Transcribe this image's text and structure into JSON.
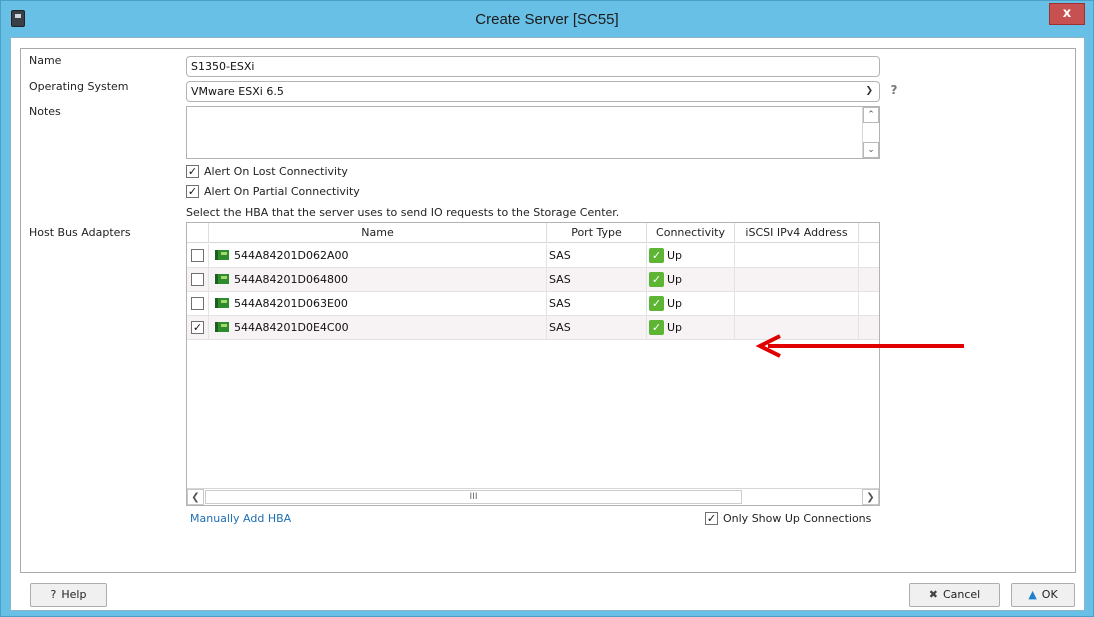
{
  "window": {
    "title": "Create Server [SC55]",
    "close_label": "x"
  },
  "form": {
    "name_label": "Name",
    "name_value": "S1350-ESXi",
    "os_label": "Operating System",
    "os_value": "VMware ESXi 6.5",
    "notes_label": "Notes",
    "notes_value": "",
    "help_q": "?",
    "alert_lost": {
      "label": "Alert On Lost Connectivity",
      "checked": true
    },
    "alert_partial": {
      "label": "Alert On Partial Connectivity",
      "checked": true
    },
    "hba_instruction": "Select the HBA that the server uses to send IO requests to the Storage Center.",
    "hba_label": "Host Bus Adapters"
  },
  "table": {
    "columns": [
      "Name",
      "Port Type",
      "Connectivity",
      "iSCSI IPv4 Address"
    ],
    "rows": [
      {
        "checked": false,
        "name": "544A84201D062A00",
        "port_type": "SAS",
        "connectivity": "Up",
        "iscsi": ""
      },
      {
        "checked": false,
        "name": "544A84201D064800",
        "port_type": "SAS",
        "connectivity": "Up",
        "iscsi": ""
      },
      {
        "checked": false,
        "name": "544A84201D063E00",
        "port_type": "SAS",
        "connectivity": "Up",
        "iscsi": ""
      },
      {
        "checked": true,
        "name": "544A84201D0E4C00",
        "port_type": "SAS",
        "connectivity": "Up",
        "iscsi": ""
      }
    ],
    "hscroll_grip": "III"
  },
  "manual_add_link": "Manually Add HBA",
  "only_show_up": {
    "label": "Only Show Up Connections",
    "checked": true
  },
  "buttons": {
    "help": "Help",
    "cancel": "Cancel",
    "ok": "OK"
  },
  "colors": {
    "titlebar": "#69c0e6",
    "close": "#c75050",
    "link": "#1f6fb2",
    "status_up": "#5db533",
    "annotation_arrow": "#e00000"
  }
}
